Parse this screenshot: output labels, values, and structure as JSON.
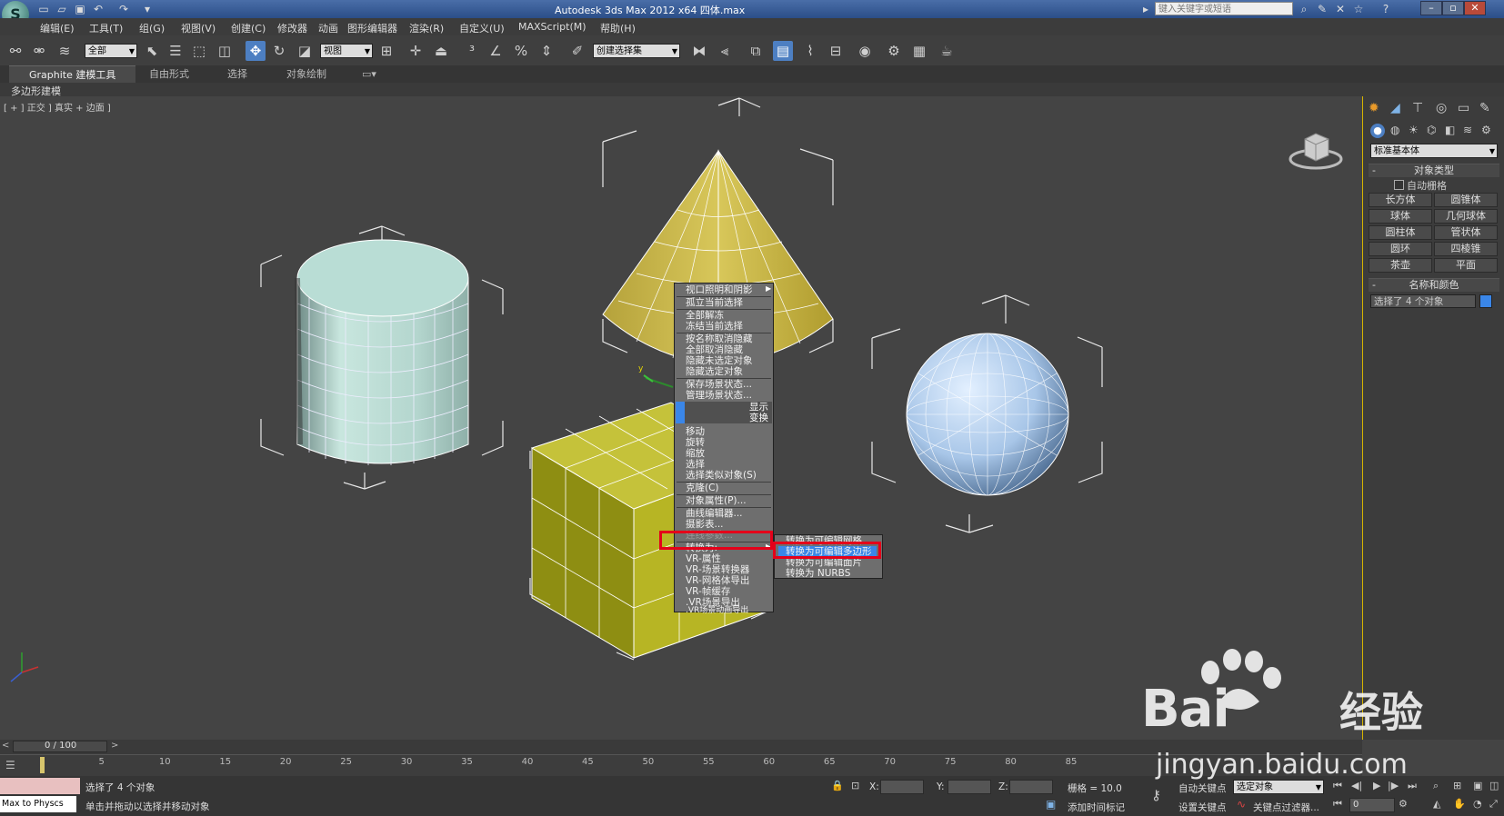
{
  "window": {
    "title": "Autodesk 3ds Max  2012 x64     四体.max",
    "search_placeholder": "键入关键字或短语"
  },
  "menubar": [
    "编辑(E)",
    "工具(T)",
    "组(G)",
    "视图(V)",
    "创建(C)",
    "修改器",
    "动画",
    "图形编辑器",
    "渲染(R)",
    "自定义(U)",
    "MAXScript(M)",
    "帮助(H)"
  ],
  "toolbar": {
    "selection_filter": "全部",
    "ref_coord": "视图",
    "named_selection": "创建选择集"
  },
  "ribbon": {
    "tabs": [
      "Graphite 建模工具",
      "自由形式",
      "选择",
      "对象绘制"
    ],
    "panel_label": "多边形建模"
  },
  "viewport": {
    "label": "[ + ] 正交 ] 真实 + 边面 ]"
  },
  "context_menu": {
    "items_top": [
      "视口照明和阴影",
      "孤立当前选择",
      "全部解冻",
      "冻结当前选择",
      "按名称取消隐藏",
      "全部取消隐藏",
      "隐藏未选定对象",
      "隐藏选定对象",
      "保存场景状态...",
      "管理场景状态..."
    ],
    "header_display": "显示",
    "header_transform": "变换",
    "items_bottom": [
      "移动",
      "旋转",
      "缩放",
      "选择",
      "选择类似对象(S)",
      "克隆(C)",
      "对象属性(P)...",
      "曲线编辑器...",
      "摄影表...",
      "连线参数...",
      "转换为:",
      "VR-属性",
      "VR-场景转换器",
      "VR-网格体导出",
      "VR-帧缓存",
      ".VR场景导出",
      ".VR场景动画导出"
    ],
    "submenu": [
      "转换为可编辑网格",
      "转换为可编辑多边形",
      "转换为可编辑面片",
      "转换为 NURBS"
    ]
  },
  "right_panel": {
    "category_dropdown": "标准基本体",
    "rollout_object_type": "对象类型",
    "auto_grid": "自动栅格",
    "buttons": [
      "长方体",
      "圆锥体",
      "球体",
      "几何球体",
      "圆柱体",
      "管状体",
      "圆环",
      "四棱锥",
      "茶壶",
      "平面"
    ],
    "rollout_name_color": "名称和颜色",
    "name_field": "选择了 4 个对象",
    "object_color": "#3a86e8"
  },
  "timeline": {
    "position": "0 / 100",
    "frame_current": 0,
    "frame_total": 100,
    "ticks": [
      "5",
      "10",
      "15",
      "20",
      "25",
      "30",
      "35",
      "40",
      "45",
      "50",
      "55",
      "60",
      "65",
      "70",
      "75",
      "80",
      "85"
    ]
  },
  "status": {
    "script_listener": "Max to Physcs",
    "selection_info": "选择了 4 个对象",
    "prompt": "单击并拖动以选择并移动对象",
    "x_label": "X:",
    "y_label": "Y:",
    "z_label": "Z:",
    "grid": "栅格 = 10.0",
    "add_time_tag": "添加时间标记",
    "auto_key": "自动关键点",
    "set_key": "设置关键点",
    "key_filter_dropdown": "选定对象",
    "key_filters": "关键点过滤器...",
    "frame_field": "0"
  },
  "watermark": {
    "brand": "Bai",
    "brand_cn": "经验",
    "url": "jingyan.baidu.com"
  },
  "colors": {
    "highlight_red": "#e4001a",
    "menu_highlight": "#3a86e8",
    "cone": "#c9b53c",
    "cube": "#a8a617",
    "cylinder": "#b9ddd5",
    "sphere": "#a8c6e8"
  }
}
